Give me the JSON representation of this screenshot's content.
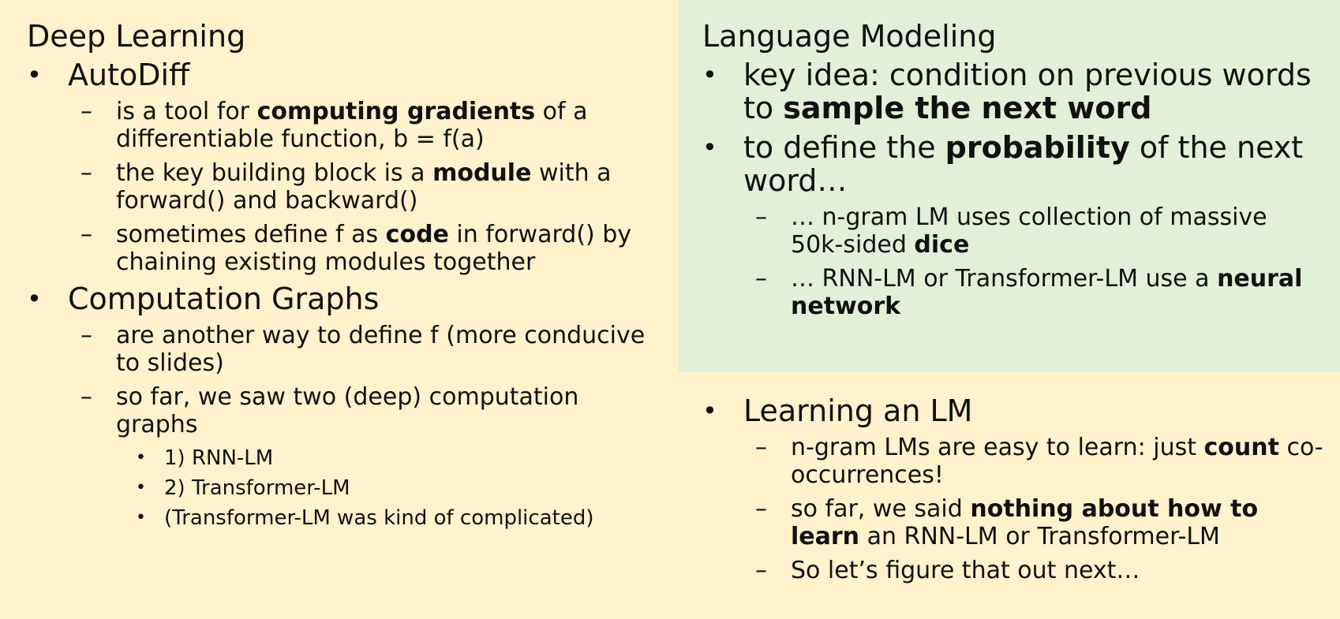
{
  "left": {
    "heading": "Deep Learning",
    "autodiff": {
      "title": "AutoDiff",
      "items": [
        {
          "pre": "is a tool for ",
          "bold": "computing gradients",
          "post": " of a differentiable function, b = f(a)"
        },
        {
          "pre": "the key building block is a ",
          "bold": "module",
          "post": " with a forward() and backward()"
        },
        {
          "pre": "sometimes define f as ",
          "bold": "code",
          "post": " in forward() by chaining existing modules together"
        }
      ]
    },
    "graphs": {
      "title": "Computation Graphs",
      "items": [
        {
          "text": "are another way to define f (more conducive to slides)"
        },
        {
          "text": "so far, we saw two (deep) computation graphs"
        }
      ],
      "subitems": [
        "1) RNN-LM",
        "2) Transformer-LM",
        "(Transformer-LM was kind of complicated)"
      ]
    }
  },
  "right_top": {
    "heading": "Language Modeling",
    "bullet1": {
      "pre": "key idea: condition on previous words to ",
      "bold": "sample the next word"
    },
    "bullet2": {
      "pre": "to define the ",
      "bold": "probability",
      "post": " of the next word…"
    },
    "items": [
      {
        "pre": "… n-gram LM uses collection of massive 50k-sided ",
        "bold": "dice"
      },
      {
        "pre": "… RNN-LM or Transformer-LM use a ",
        "bold": "neural network"
      }
    ]
  },
  "right_bottom": {
    "title": "Learning an LM",
    "items": [
      {
        "pre": "n-gram LMs are easy to learn: just ",
        "bold": "count",
        "post": " co-occurrences!"
      },
      {
        "pre": "so far, we said ",
        "bold": "nothing about how to learn",
        "post": " an RNN-LM or Transformer-LM"
      },
      {
        "pre": "So let’s figure that out next…"
      }
    ]
  },
  "marks": {
    "bullet": "•",
    "dash": "–",
    "dot": "•"
  },
  "colors": {
    "background": "#fff2cc",
    "green_box": "#e2efd9"
  }
}
